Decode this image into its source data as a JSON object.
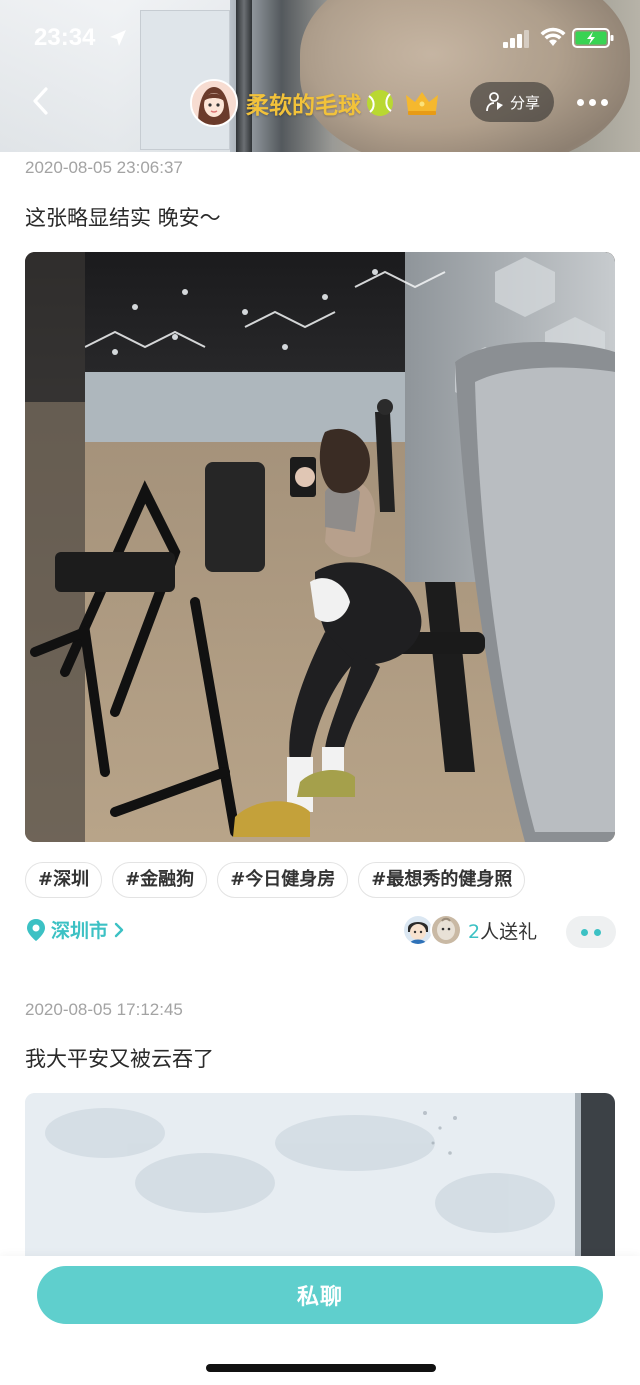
{
  "status_bar": {
    "time": "23:34"
  },
  "header": {
    "nickname": "柔软的毛球",
    "share_label": "分享",
    "icons": [
      "back-icon",
      "avatar",
      "tennis-ball-icon",
      "crown-icon",
      "share-person-icon",
      "more-icon"
    ]
  },
  "posts": [
    {
      "timestamp": "2020-08-05 23:06:37",
      "text": "这张略显结实 晚安～",
      "tags": [
        "#深圳",
        "#金融狗",
        "#今日健身房",
        "#最想秀的健身照"
      ],
      "location": "深圳市",
      "gift_count": "2",
      "gift_suffix": "人送礼"
    },
    {
      "timestamp": "2020-08-05 17:12:45",
      "text": "我大平安又被云吞了"
    }
  ],
  "bottom": {
    "chat_label": "私聊"
  },
  "colors": {
    "accent": "#3cc1c4",
    "button": "#5fcfcd",
    "nickname": "#f2c23a"
  }
}
